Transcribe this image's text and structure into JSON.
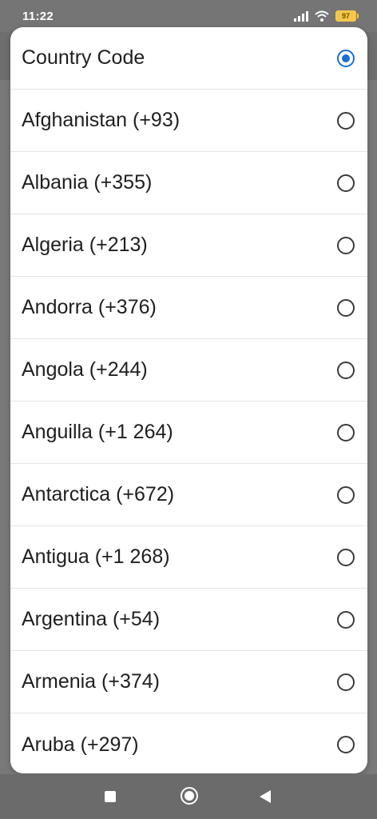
{
  "status_bar": {
    "time": "11:22",
    "battery_level": "97",
    "icons": [
      "signal-icon",
      "wifi-icon",
      "battery-icon"
    ]
  },
  "dialog": {
    "title": "Country Code",
    "title_selected": true,
    "accent_color": "#1a6fd1",
    "options": [
      {
        "label": "Afghanistan (+93)",
        "selected": false
      },
      {
        "label": "Albania (+355)",
        "selected": false
      },
      {
        "label": "Algeria (+213)",
        "selected": false
      },
      {
        "label": "Andorra (+376)",
        "selected": false
      },
      {
        "label": "Angola (+244)",
        "selected": false
      },
      {
        "label": "Anguilla (+1 264)",
        "selected": false
      },
      {
        "label": "Antarctica (+672)",
        "selected": false
      },
      {
        "label": "Antigua (+1 268)",
        "selected": false
      },
      {
        "label": "Argentina (+54)",
        "selected": false
      },
      {
        "label": "Armenia (+374)",
        "selected": false
      },
      {
        "label": "Aruba (+297)",
        "selected": false
      }
    ]
  },
  "nav_bar": {
    "icons": [
      "recent-apps-icon",
      "home-icon",
      "back-icon"
    ]
  }
}
